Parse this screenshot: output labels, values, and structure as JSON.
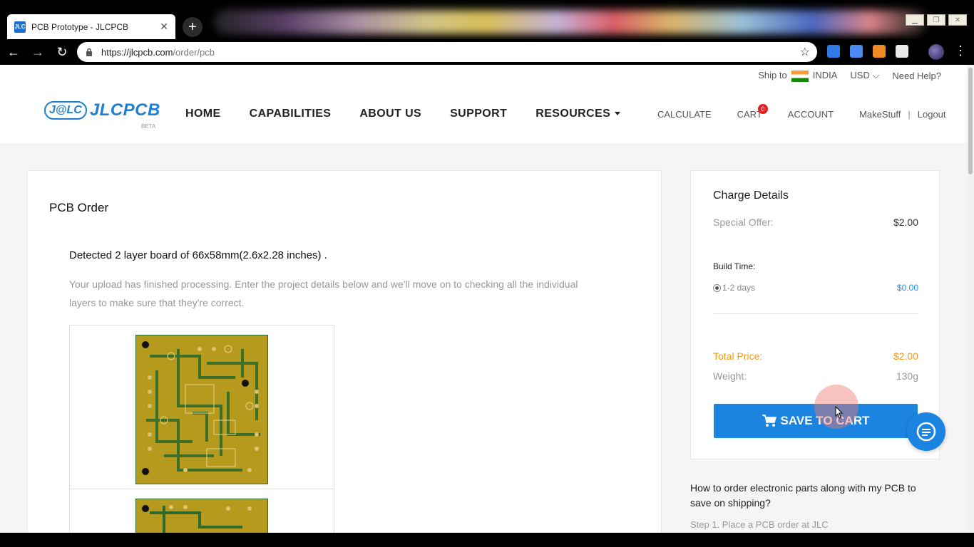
{
  "browser": {
    "tab_title": "PCB Prototype - JLCPCB",
    "tab_favicon_text": "JLC",
    "url_host": "https://jlcpcb.com",
    "url_path": "/order/pcb"
  },
  "header": {
    "ship_to_label": "Ship to",
    "country": "INDIA",
    "currency": "USD",
    "help": "Need Help?",
    "logo_badge": "J@LC",
    "logo_text": "JLCPCB",
    "logo_beta": "BETA",
    "nav": [
      "HOME",
      "CAPABILITIES",
      "ABOUT US",
      "SUPPORT",
      "RESOURCES"
    ],
    "calculate": "CALCULATE",
    "cart": "CART",
    "cart_count": "0",
    "account": "ACCOUNT",
    "username": "MakeStuff",
    "separator": "|",
    "logout": "Logout"
  },
  "order": {
    "title": "PCB Order",
    "detected": "Detected 2 layer board of 66x58mm(2.6x2.28 inches) .",
    "message": "Your upload has finished processing. Enter the project details below and we'll move on to checking all the individual layers to make sure that they're correct."
  },
  "charges": {
    "title": "Charge Details",
    "special_offer_label": "Special Offer:",
    "special_offer_value": "$2.00",
    "build_time_label": "Build Time:",
    "build_option": "1-2 days",
    "build_option_price": "$0.00",
    "total_label": "Total Price:",
    "total_value": "$2.00",
    "weight_label": "Weight:",
    "weight_value": "130g",
    "save_to_cart": "SAVE TO CART"
  },
  "faq": {
    "question": "How to order electronic parts along with my PCB to save on shipping?",
    "step1": "Step 1. Place a PCB order at JLC"
  },
  "colors": {
    "brand_blue": "#1a84e0",
    "total_orange": "#f29a1a",
    "pcb_gold": "#b59a1e",
    "pcb_green": "#2f6a2a"
  }
}
